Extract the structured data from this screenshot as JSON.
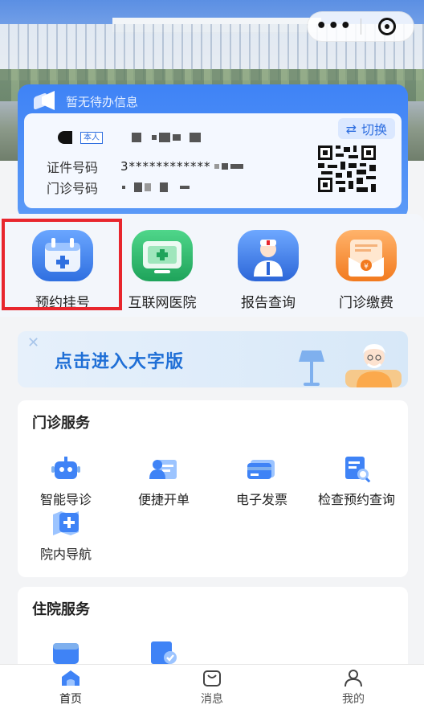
{
  "header": {
    "menu_dots": "•••"
  },
  "info_card": {
    "notice": "暂无待办信息",
    "switch_label": "切换",
    "self_tag": "本人",
    "id_label": "证件号码",
    "id_value": "3************",
    "clinic_label": "门诊号码"
  },
  "quick_services": [
    {
      "label": "预约挂号",
      "icon": "calendar-plus-icon"
    },
    {
      "label": "互联网医院",
      "icon": "monitor-plus-icon"
    },
    {
      "label": "报告查询",
      "icon": "doctor-icon"
    },
    {
      "label": "门诊缴费",
      "icon": "envelope-yen-icon"
    }
  ],
  "banner": {
    "title": "点击进入大字版"
  },
  "outpatient": {
    "title": "门诊服务",
    "items": [
      {
        "label": "智能导诊",
        "icon": "robot-icon"
      },
      {
        "label": "便捷开单",
        "icon": "user-card-icon"
      },
      {
        "label": "电子发票",
        "icon": "card-icon"
      },
      {
        "label": "检查预约查询",
        "icon": "search-doc-icon"
      },
      {
        "label": "院内导航",
        "icon": "map-plus-icon"
      }
    ]
  },
  "inpatient": {
    "title": "住院服务",
    "items": [
      {
        "icon": "wallet-icon"
      },
      {
        "icon": "checked-doc-icon"
      }
    ]
  },
  "tabbar": [
    {
      "label": "首页",
      "icon": "home-icon",
      "active": true
    },
    {
      "label": "消息",
      "icon": "bag-icon",
      "active": false
    },
    {
      "label": "我的",
      "icon": "person-icon",
      "active": false
    }
  ],
  "colors": {
    "brand_blue": "#3f83f6",
    "highlight_red": "#e8262d"
  }
}
